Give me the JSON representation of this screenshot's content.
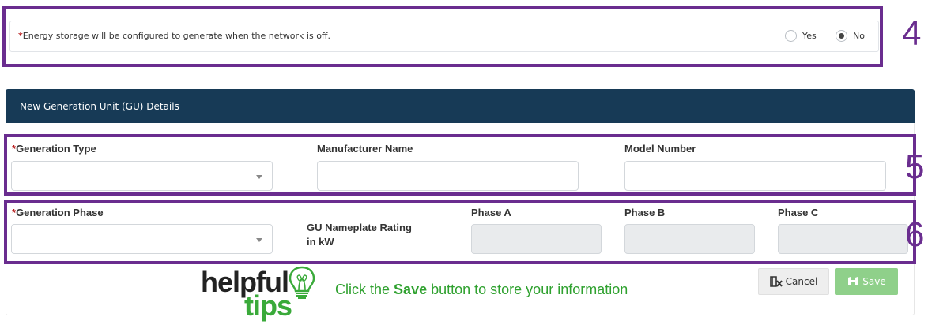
{
  "energy_storage": {
    "required_mark": "*",
    "notice_text": "Energy storage will be configured to generate when the network is off.",
    "options": [
      {
        "label": "Yes",
        "selected": false
      },
      {
        "label": "No",
        "selected": true
      }
    ]
  },
  "steps": {
    "four": "4",
    "five": "5",
    "six": "6"
  },
  "gu_section": {
    "title": "New Generation Unit (GU) Details",
    "generation_type": {
      "required_mark": "*",
      "label": "Generation Type",
      "value": ""
    },
    "manufacturer_name": {
      "label": "Manufacturer Name",
      "value": ""
    },
    "model_number": {
      "label": "Model Number",
      "value": ""
    },
    "generation_phase": {
      "required_mark": "*",
      "label": "Generation Phase",
      "value": ""
    },
    "nameplate_label_line1": "GU Nameplate Rating",
    "nameplate_label_line2": "in kW",
    "phase_a": {
      "label": "Phase A",
      "value": ""
    },
    "phase_b": {
      "label": "Phase B",
      "value": ""
    },
    "phase_c": {
      "label": "Phase C",
      "value": ""
    }
  },
  "buttons": {
    "cancel_label": "Cancel",
    "save_label": "Save",
    "cancel_icon": "cancel-x-icon",
    "save_icon": "save-icon"
  },
  "tips": {
    "logo_word1": "helpful",
    "logo_word2": "tips",
    "logo_icon": "lightbulb-icon",
    "text_before": "Click the",
    "text_bold": "Save",
    "text_after": "button to store your information"
  },
  "colors": {
    "frame": "#6a2d8f",
    "header_bg": "#173a56",
    "save_button": "#8fd08a",
    "tips_green": "#2fa12f",
    "required": "#b71c1c"
  }
}
